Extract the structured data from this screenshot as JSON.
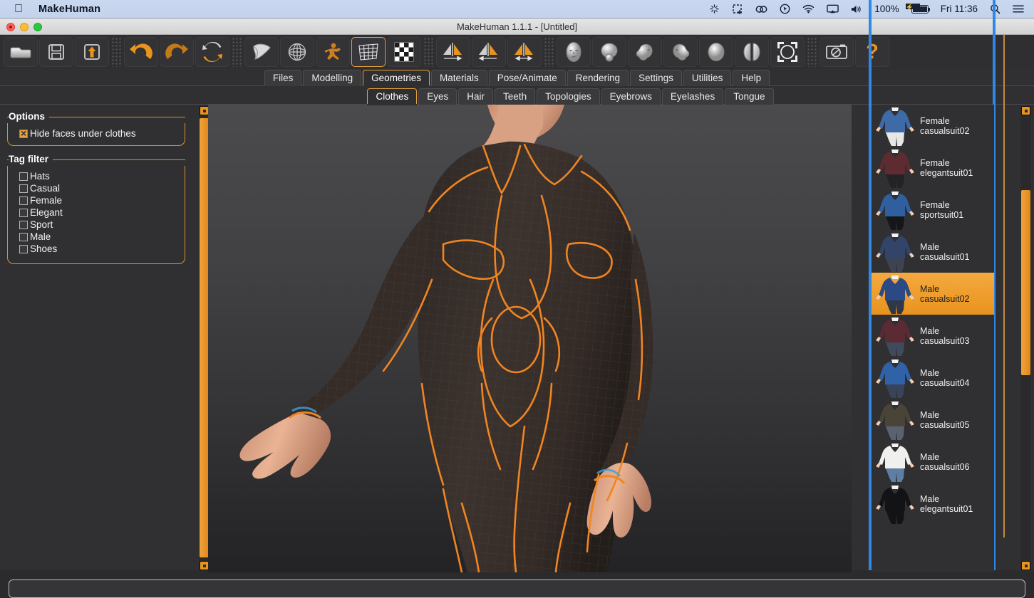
{
  "macbar": {
    "apple_glyph": "",
    "app_name": "MakeHuman",
    "battery_pct": "100%",
    "clock": "Fri 11:36",
    "icons": [
      "brightness-sparkle-icon",
      "screenshot-selection-icon",
      "creative-cloud-icon",
      "cursor-tracker-icon",
      "wifi-icon",
      "airplay-icon",
      "volume-icon",
      "battery-charging-icon",
      "search-icon",
      "notification-list-icon"
    ]
  },
  "window": {
    "title": "MakeHuman 1.1.1 - [Untitled]",
    "traffic_lights": [
      "close-button",
      "minimize-button",
      "zoom-button"
    ]
  },
  "toolbar": {
    "buttons": [
      {
        "name": "load-button",
        "icon": "folder-icon",
        "active": false
      },
      {
        "name": "save-button",
        "icon": "floppy-disk-icon",
        "active": false
      },
      {
        "name": "export-button",
        "icon": "export-up-arrow-icon",
        "active": false
      },
      {
        "name": "undo-button",
        "icon": "undo-arrow-icon",
        "active": false
      },
      {
        "name": "redo-button",
        "icon": "redo-arrow-icon",
        "active": false
      },
      {
        "name": "reset-mesh-button",
        "icon": "refresh-circular-arrows-icon",
        "active": false
      },
      {
        "name": "smooth-button",
        "icon": "smooth-surface-icon",
        "active": false
      },
      {
        "name": "wireframe-button",
        "icon": "wireframe-globe-icon",
        "active": false
      },
      {
        "name": "pose-button",
        "icon": "posed-figure-icon",
        "active": false
      },
      {
        "name": "grid-button",
        "icon": "grid-icon",
        "active": true
      },
      {
        "name": "background-button",
        "icon": "checkerboard-icon",
        "active": false
      },
      {
        "name": "symmetry-right-button",
        "icon": "symmetry-right-icon",
        "active": false
      },
      {
        "name": "symmetry-left-button",
        "icon": "symmetry-left-icon",
        "active": false
      },
      {
        "name": "symmetry-both-button",
        "icon": "symmetry-both-icon",
        "active": false
      },
      {
        "name": "front-view-button",
        "icon": "face-front-icon",
        "active": false
      },
      {
        "name": "top-view-button",
        "icon": "head-top-icon",
        "active": false
      },
      {
        "name": "right-view-button",
        "icon": "head-right-icon",
        "active": false
      },
      {
        "name": "left-view-button",
        "icon": "head-left-icon",
        "active": false
      },
      {
        "name": "back-view-button",
        "icon": "head-back-icon",
        "active": false
      },
      {
        "name": "side-pair-view-button",
        "icon": "head-pair-icon",
        "active": false
      },
      {
        "name": "reset-camera-button",
        "icon": "frame-circle-icon",
        "active": false
      },
      {
        "name": "grab-screen-button",
        "icon": "camera-icon",
        "active": false
      },
      {
        "name": "help-button",
        "icon": "question-mark-icon",
        "active": false
      }
    ]
  },
  "main_tabs": [
    {
      "label": "Files",
      "selected": false
    },
    {
      "label": "Modelling",
      "selected": false
    },
    {
      "label": "Geometries",
      "selected": true
    },
    {
      "label": "Materials",
      "selected": false
    },
    {
      "label": "Pose/Animate",
      "selected": false
    },
    {
      "label": "Rendering",
      "selected": false
    },
    {
      "label": "Settings",
      "selected": false
    },
    {
      "label": "Utilities",
      "selected": false
    },
    {
      "label": "Help",
      "selected": false
    }
  ],
  "sub_tabs": [
    {
      "label": "Clothes",
      "selected": true
    },
    {
      "label": "Eyes",
      "selected": false
    },
    {
      "label": "Hair",
      "selected": false
    },
    {
      "label": "Teeth",
      "selected": false
    },
    {
      "label": "Topologies",
      "selected": false
    },
    {
      "label": "Eyebrows",
      "selected": false
    },
    {
      "label": "Eyelashes",
      "selected": false
    },
    {
      "label": "Tongue",
      "selected": false
    }
  ],
  "left_panel": {
    "options_title": "Options",
    "options": [
      {
        "label": "Hide faces under clothes",
        "checked": true
      }
    ],
    "tag_filter_title": "Tag filter",
    "tags": [
      {
        "label": "Hats",
        "checked": false
      },
      {
        "label": "Casual",
        "checked": false
      },
      {
        "label": "Female",
        "checked": false
      },
      {
        "label": "Elegant",
        "checked": false
      },
      {
        "label": "Sport",
        "checked": false
      },
      {
        "label": "Male",
        "checked": false
      },
      {
        "label": "Shoes",
        "checked": false
      }
    ]
  },
  "clothes_list": [
    {
      "line1": "Female",
      "line2": "casualsuit02",
      "selected": false,
      "top": "#3f6aa8",
      "bottom": "#e7e7e7"
    },
    {
      "line1": "Female",
      "line2": "elegantsuit01",
      "selected": false,
      "top": "#5d2b31",
      "bottom": "#232326"
    },
    {
      "line1": "Female",
      "line2": "sportsuit01",
      "selected": false,
      "top": "#2f5f9e",
      "bottom": "#15151a"
    },
    {
      "line1": "Male",
      "line2": "casualsuit01",
      "selected": false,
      "top": "#32446a",
      "bottom": "#3d4352"
    },
    {
      "line1": "Male",
      "line2": "casualsuit02",
      "selected": true,
      "top": "#2b4a85",
      "bottom": "#303747"
    },
    {
      "line1": "Male",
      "line2": "casualsuit03",
      "selected": false,
      "top": "#5b2a33",
      "bottom": "#3f4a5e"
    },
    {
      "line1": "Male",
      "line2": "casualsuit04",
      "selected": false,
      "top": "#2f62a6",
      "bottom": "#39445a"
    },
    {
      "line1": "Male",
      "line2": "casualsuit05",
      "selected": false,
      "top": "#4a4438",
      "bottom": "#5a6272"
    },
    {
      "line1": "Male",
      "line2": "casualsuit06",
      "selected": false,
      "top": "#f0f0ee",
      "bottom": "#5f7ea4"
    },
    {
      "line1": "Male",
      "line2": "elegantsuit01",
      "selected": false,
      "top": "#131316",
      "bottom": "#131316"
    }
  ],
  "viewport": {
    "model_alt": "3d-human-model-in-dark-bodysuit-with-orange-seams",
    "cursor_label": "mouse-pointer"
  },
  "status_bar": {
    "text": ""
  },
  "colors": {
    "accent_orange": "#e8941f",
    "panel_border_orange": "#d9932e",
    "selection_blue": "#2f87e8",
    "panel_bg": "#303032",
    "toolbar_bg": "#2f2f31"
  },
  "scrollbars": {
    "left_viewport": {
      "name": "viewport-vertical-scrollbar"
    },
    "right_list": {
      "name": "clothes-list-vertical-scrollbar"
    }
  }
}
